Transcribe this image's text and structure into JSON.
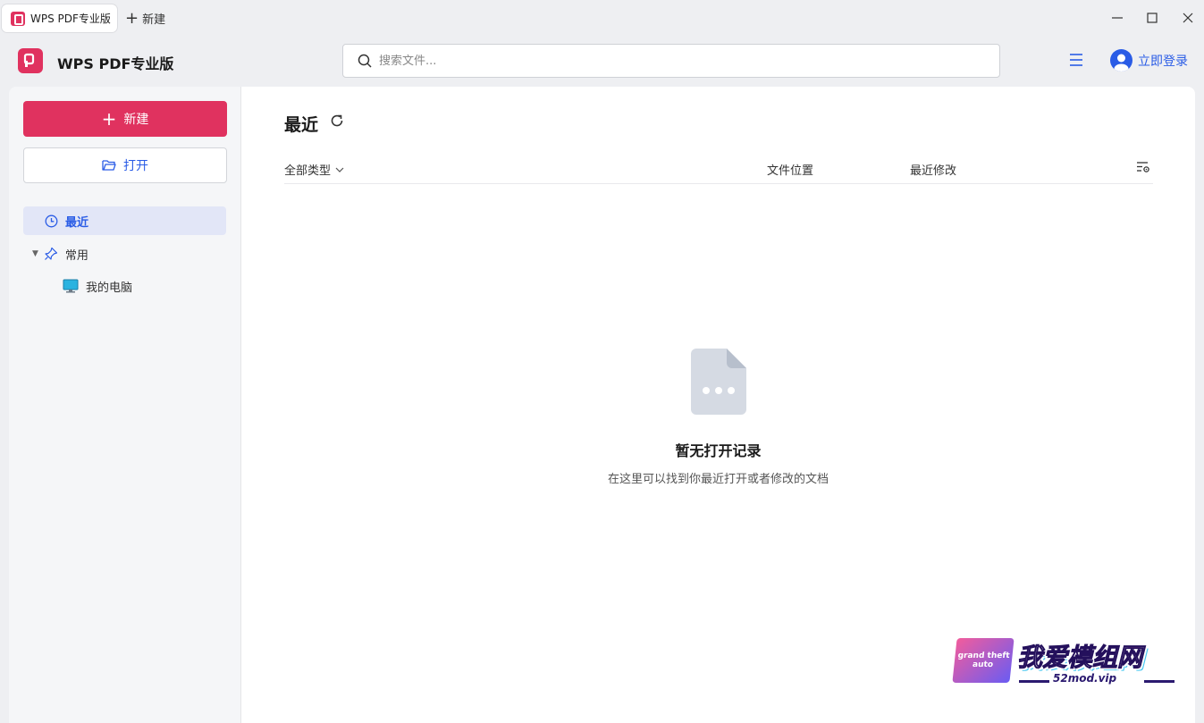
{
  "titlebar": {
    "tab_title": "WPS PDF专业版",
    "new_tab_label": "新建",
    "minimize": "—",
    "maximize": "☐",
    "close": "✕"
  },
  "header": {
    "app_title": "WPS PDF专业版",
    "search_placeholder": "搜索文件...",
    "login_label": "立即登录"
  },
  "sidebar": {
    "new_label": "新建",
    "open_label": "打开",
    "nav": {
      "recent": "最近",
      "common": "常用",
      "my_computer": "我的电脑"
    }
  },
  "main": {
    "title": "最近",
    "columns": {
      "type": "全部类型",
      "location": "文件位置",
      "modified": "最近修改"
    },
    "empty_title": "暂无打开记录",
    "empty_desc": "在这里可以找到你最近打开或者修改的文档"
  },
  "watermark": {
    "badge": "grand theft auto",
    "title": "我爱模组网",
    "url": "52mod.vip"
  },
  "colors": {
    "accent": "#e0325f",
    "link": "#2a5ce6",
    "selected_bg": "#e2e6f7"
  }
}
